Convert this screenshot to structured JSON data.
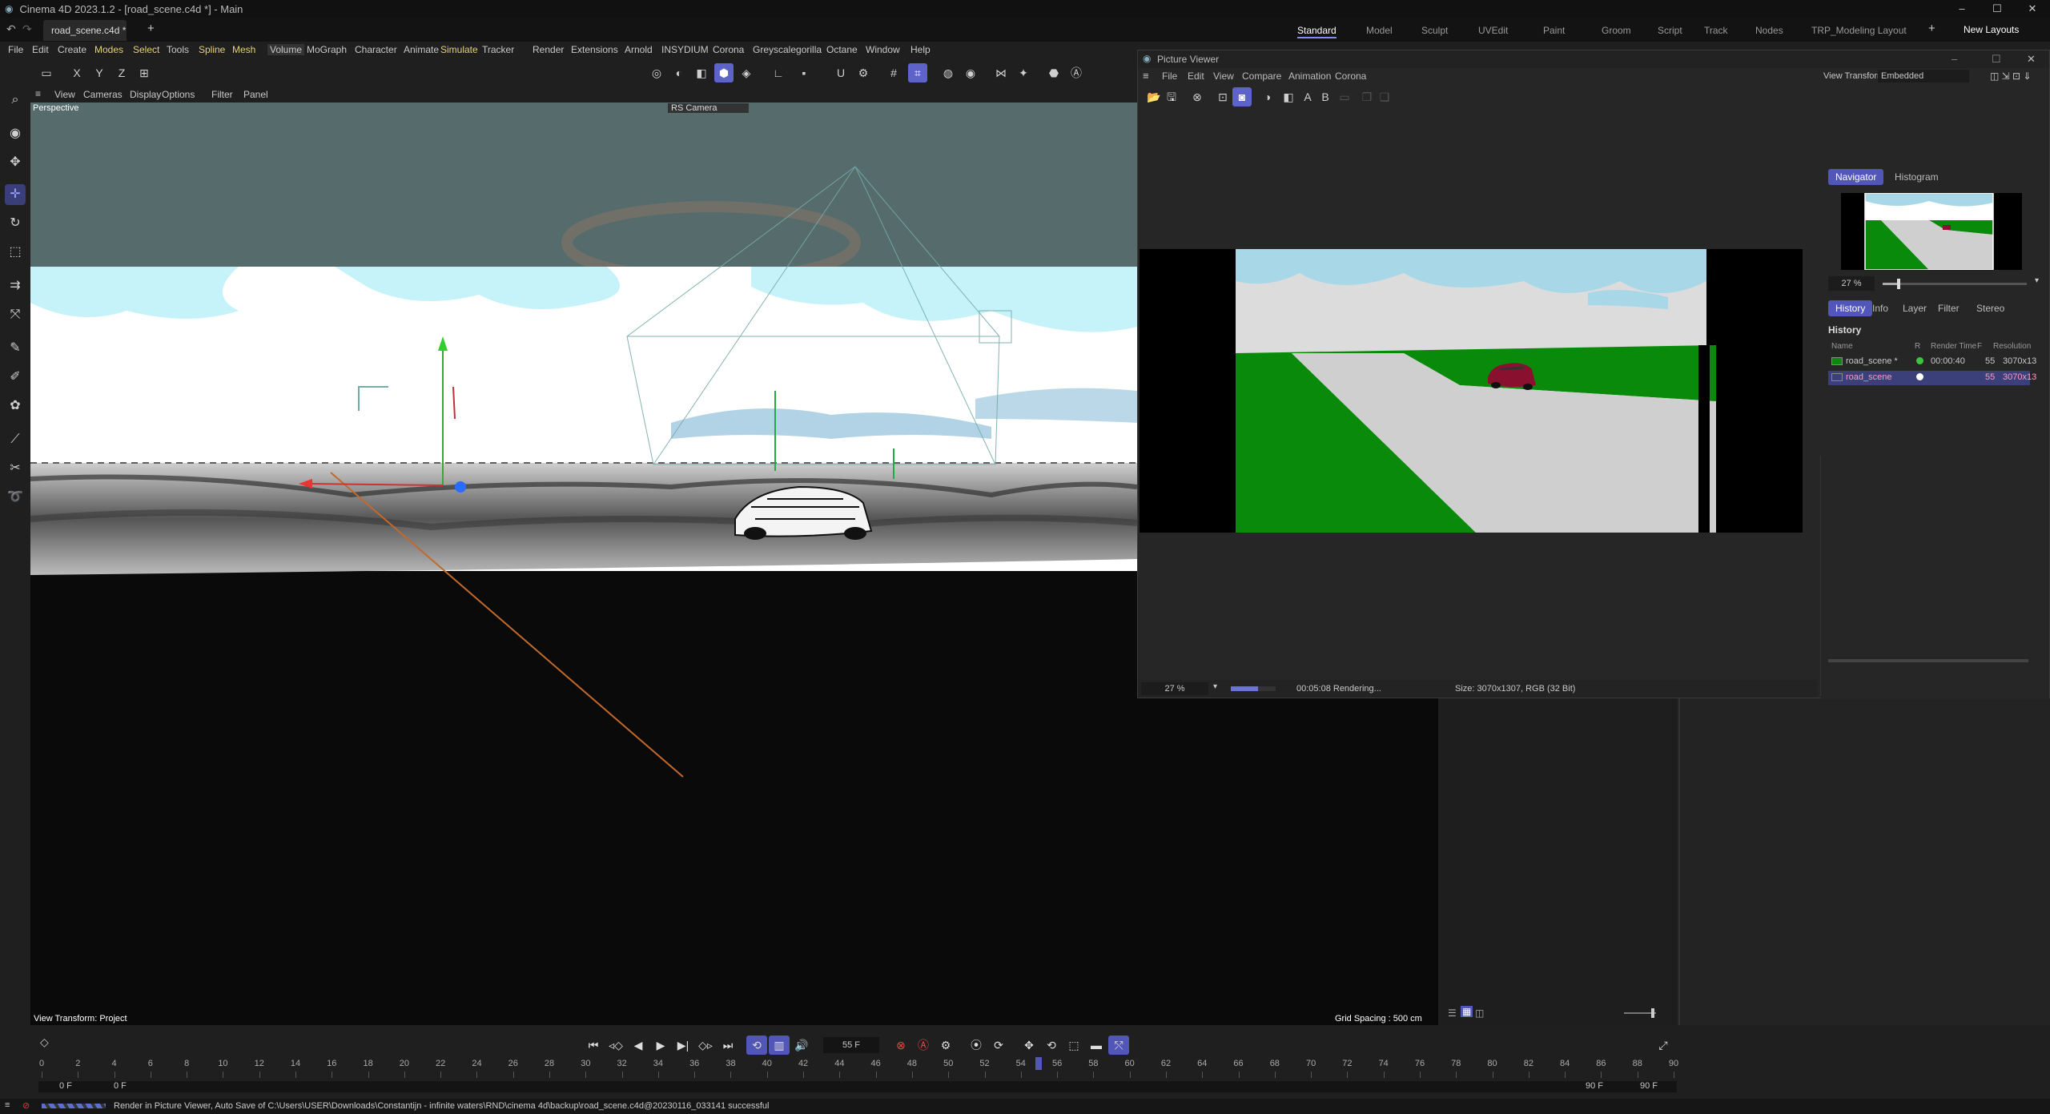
{
  "window": {
    "title": "Cinema 4D 2023.1.2 - [road_scene.c4d *] - Main",
    "doc_tab": "road_scene.c4d *",
    "new_tab": "+"
  },
  "layouts": [
    "Standard",
    "Model",
    "Sculpt",
    "UVEdit",
    "Paint",
    "Groom",
    "Script",
    "Track",
    "Nodes",
    "TRP_Modeling Layout"
  ],
  "layouts_add": "+",
  "new_layouts": "New Layouts",
  "menu": [
    "File",
    "Edit",
    "Create",
    "Modes",
    "Select",
    "Tools",
    "Spline",
    "Mesh",
    "Volume",
    "MoGraph",
    "Character",
    "Animate",
    "Simulate",
    "Tracker",
    "Render",
    "Extensions",
    "Arnold",
    "INSYDIUM",
    "Corona",
    "Greyscalegorilla",
    "Octane",
    "Window",
    "Help"
  ],
  "viewport": {
    "menu": [
      "View",
      "Cameras",
      "Display",
      "Options",
      "Filter",
      "Panel"
    ],
    "label": "Perspective",
    "camera": "RS Camera",
    "view_transform": "View Transform: Project",
    "grid_spacing": "Grid Spacing : 500 cm"
  },
  "picture_viewer": {
    "title": "Picture Viewer",
    "menu": [
      "File",
      "Edit",
      "View",
      "Compare",
      "Animation",
      "Corona"
    ],
    "view_transform_label": "View Transform",
    "view_transform_value": "Embedded",
    "nav_tabs": [
      "Navigator",
      "Histogram"
    ],
    "zoom": "27 %",
    "zoom_slider": 0.1,
    "info_tabs": [
      "History",
      "Info",
      "Layer",
      "Filter",
      "Stereo"
    ],
    "history_title": "History",
    "history_headers": [
      "Name",
      "R",
      "Render Time",
      "F",
      "Resolution"
    ],
    "history_rows": [
      {
        "name": "road_scene *",
        "time": "00:00:40",
        "frame": "55",
        "res": "3070x13",
        "status_color": "#3ec43e"
      },
      {
        "name": "road_scene",
        "time": "",
        "frame": "55",
        "res": "3070x13",
        "status_color": "#ffffff"
      }
    ],
    "status_zoom": "27 %",
    "render_progress": 0.6,
    "status_text": "00:05:08 Rendering...",
    "size_text": "Size: 3070x1307, RGB (32 Bit)"
  },
  "timeline": {
    "ticks": [
      0,
      2,
      4,
      6,
      8,
      10,
      12,
      14,
      16,
      18,
      20,
      22,
      24,
      26,
      28,
      30,
      32,
      34,
      36,
      38,
      40,
      42,
      44,
      46,
      48,
      50,
      52,
      54,
      56,
      58,
      60,
      62,
      64,
      66,
      68,
      70,
      72,
      74,
      76,
      78,
      80,
      82,
      84,
      86,
      88,
      90
    ],
    "current_frame": "55 F",
    "playhead_frame": 55,
    "start": "0 F",
    "start2": "0 F",
    "end": "90 F",
    "end2": "90 F"
  },
  "statusbar": "Render in Picture Viewer, Auto Save of C:\\Users\\USER\\Downloads\\Constantijn - infinite waters\\RND\\cinema 4d\\backup\\road_scene.c4d@20230116_033141 successful",
  "colors": {
    "accent": "#5d63c8",
    "sky": "#a8d8e8",
    "grass": "#0a8a0a",
    "road": "#cfcfcf",
    "car": "#8a1030"
  }
}
